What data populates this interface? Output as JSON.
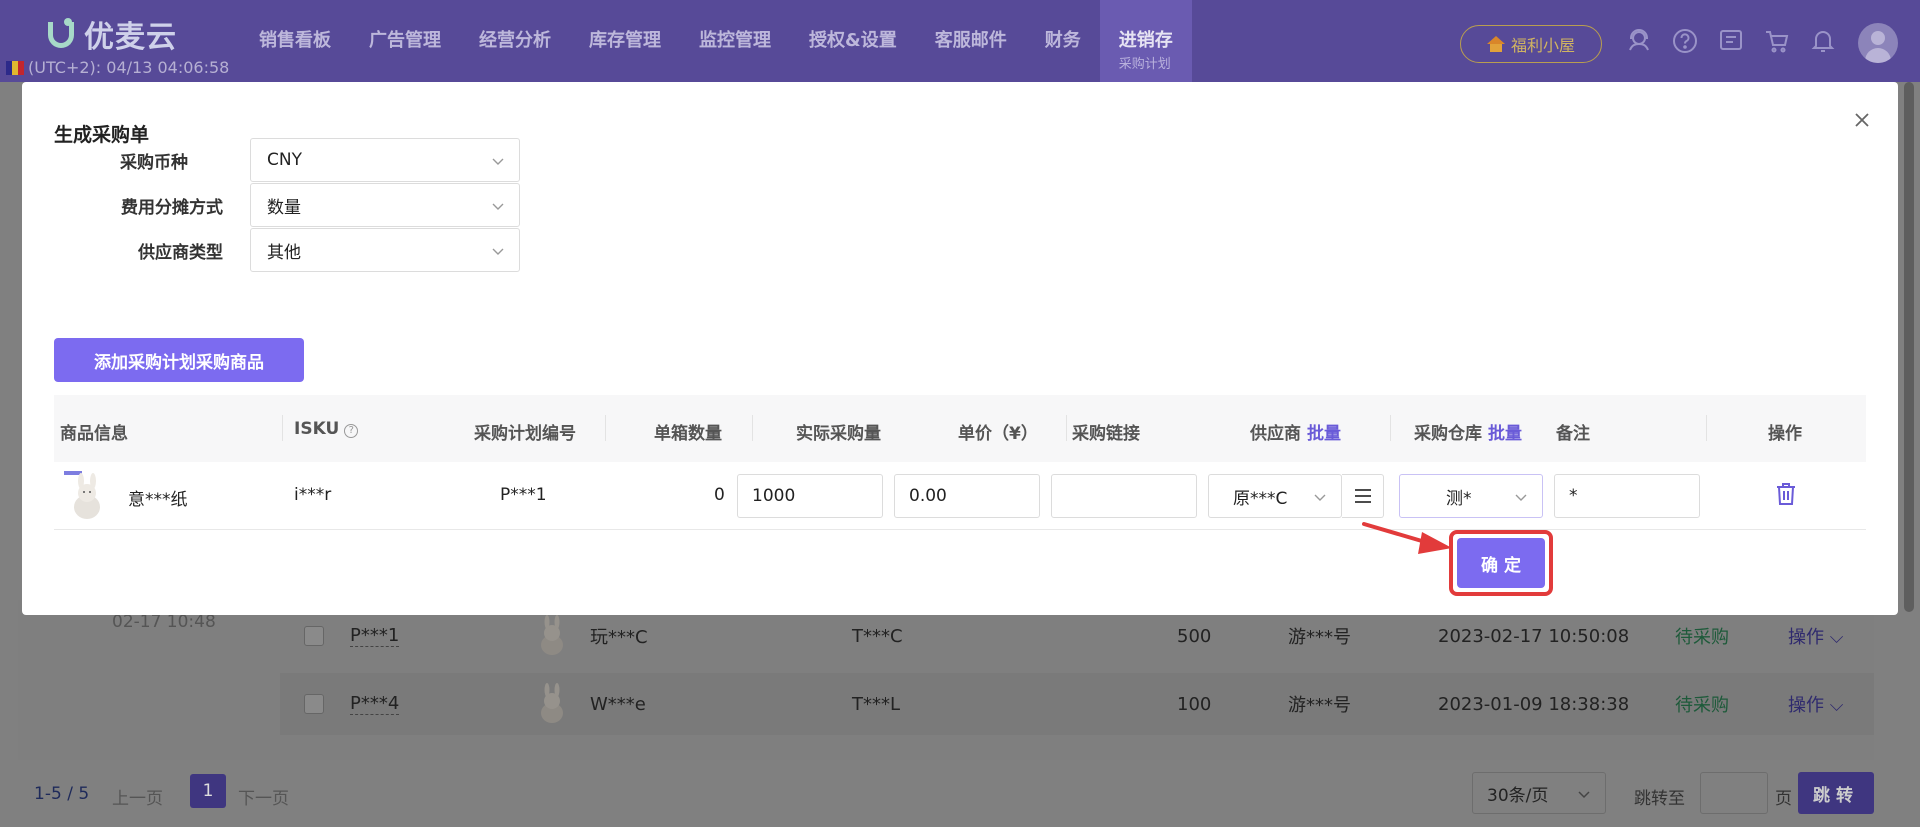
{
  "nav": {
    "logo": "优麦云",
    "timezone": "(UTC+2): 04/13 04:06:58",
    "items": [
      "销售看板",
      "广告管理",
      "经营分析",
      "库存管理",
      "监控管理",
      "授权&设置",
      "客服邮件",
      "财务"
    ],
    "active": {
      "label": "进销存",
      "sub": "采购计划"
    },
    "welfare": "福利小屋",
    "icons": [
      "headset-icon",
      "help-icon",
      "message-icon",
      "cart-icon",
      "bell-icon",
      "avatar"
    ]
  },
  "modal": {
    "title": "生成采购单",
    "form": [
      {
        "label": "采购币种",
        "value": "CNY"
      },
      {
        "label": "费用分摊方式",
        "value": "数量"
      },
      {
        "label": "供应商类型",
        "value": "其他"
      }
    ],
    "add_button": "添加采购计划采购商品",
    "table": {
      "headers": {
        "product": "商品信息",
        "isku": "ISKU",
        "plan_no": "采购计划编号",
        "box_qty": "单箱数量",
        "actual_qty": "实际采购量",
        "unit_price": "单价（¥）",
        "link": "采购链接",
        "supplier": "供应商",
        "warehouse": "采购仓库",
        "batch": "批量",
        "remark": "备注",
        "ops": "操作"
      },
      "row": {
        "product_name": "意***纸",
        "isku": "i***r",
        "plan_no": "P***1",
        "box_qty": "0",
        "actual_qty": "1000",
        "unit_price": "0.00",
        "link": "",
        "supplier": "原***C",
        "warehouse": "测*",
        "remark": "*"
      }
    },
    "confirm": "确定"
  },
  "background": {
    "date": "02-17 10:48",
    "rows": [
      {
        "plan": "P***1",
        "name": "玩***C",
        "code": "T***C",
        "qty": "500",
        "warehouse": "游***号",
        "time": "2023-02-17 10:50:08",
        "status": "待采购",
        "op": "操作"
      },
      {
        "plan": "P***4",
        "name": "W***e",
        "code": "T***L",
        "qty": "100",
        "warehouse": "游***号",
        "time": "2023-01-09 18:38:38",
        "status": "待采购",
        "op": "操作"
      }
    ],
    "pager": {
      "range": "1-5",
      "sep": "/",
      "total": "5",
      "prev": "上一页",
      "page": "1",
      "next": "下一页",
      "size": "30条/页",
      "jump": "跳转至",
      "unit": "页",
      "go": "跳转"
    }
  }
}
